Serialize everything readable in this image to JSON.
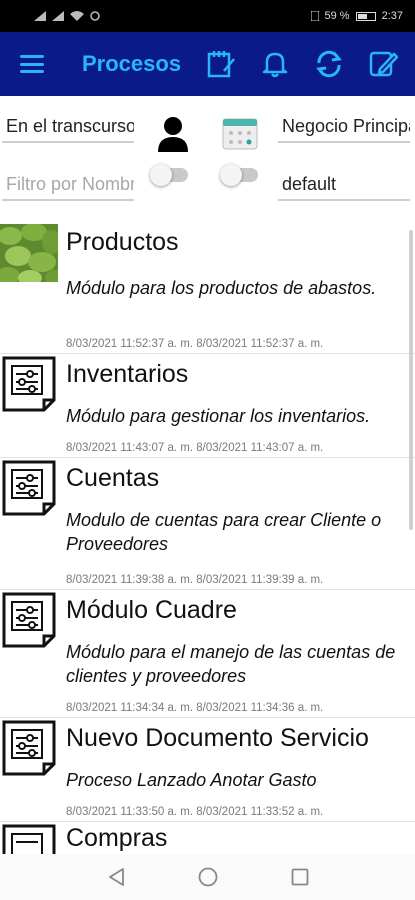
{
  "status_bar": {
    "battery_text": "59 %",
    "time": "2:37"
  },
  "app_bar": {
    "title": "Procesos"
  },
  "filters": {
    "period_value": "En el transcurso",
    "business_value": "Negocio Principal",
    "name_filter_placeholder": "Filtro por Nombre",
    "template_value": "default"
  },
  "items": [
    {
      "title": "Productos",
      "description": "Módulo para los productos de abastos.",
      "created": "8/03/2021 11:52:37 a. m.",
      "updated": "8/03/2021 11:52:37 a. m.",
      "icon": "produce-photo-icon"
    },
    {
      "title": "Inventarios",
      "description": "Módulo para gestionar los inventarios.",
      "created": "8/03/2021 11:43:07 a. m.",
      "updated": "8/03/2021 11:43:07 a. m.",
      "icon": "process-document-icon"
    },
    {
      "title": "Cuentas",
      "description": "Modulo de cuentas para crear Cliente o Proveedores",
      "created": "8/03/2021 11:39:38 a. m.",
      "updated": "8/03/2021 11:39:39 a. m.",
      "icon": "process-document-icon"
    },
    {
      "title": "Módulo Cuadre",
      "description": "Módulo para el manejo de las cuentas de clientes y proveedores",
      "created": "8/03/2021 11:34:34 a. m.",
      "updated": "8/03/2021 11:34:36 a. m.",
      "icon": "process-document-icon"
    },
    {
      "title": "Nuevo Documento Servicio",
      "description": "Proceso Lanzado Anotar Gasto",
      "created": "8/03/2021 11:33:50 a. m.",
      "updated": "8/03/2021 11:33:52 a. m.",
      "icon": "process-document-icon"
    },
    {
      "title": "Compras",
      "description": "",
      "created": "",
      "updated": "",
      "icon": "process-document-icon"
    }
  ],
  "colors": {
    "app_bar": "#0a1a8a",
    "accent": "#29b6f6"
  }
}
